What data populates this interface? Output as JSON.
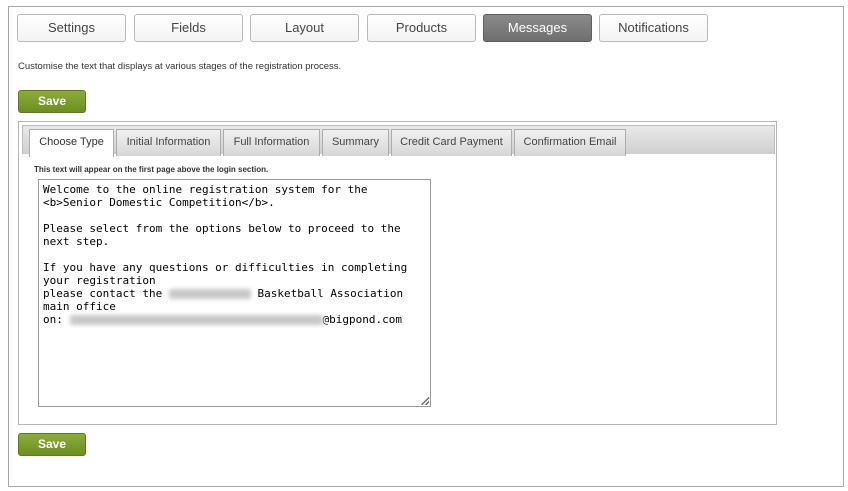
{
  "top_tabs": [
    {
      "label": "Settings"
    },
    {
      "label": "Fields"
    },
    {
      "label": "Layout"
    },
    {
      "label": "Products"
    },
    {
      "label": "Messages",
      "active": true
    },
    {
      "label": "Notifications"
    }
  ],
  "intro_text": "Customise the text that displays at various stages of the registration process.",
  "save_label": "Save",
  "sub_tabs": [
    {
      "label": "Choose Type",
      "active": true
    },
    {
      "label": "Initial Information"
    },
    {
      "label": "Full Information"
    },
    {
      "label": "Summary"
    },
    {
      "label": "Credit Card Payment"
    },
    {
      "label": "Confirmation Email"
    }
  ],
  "helper_text": "This text will appear on the first page above the login section.",
  "message": {
    "line1": "Welcome to the online registration system for the <b>Senior Domestic Competition</b>.",
    "line2": "Please select from the options below to proceed to the next step.",
    "line3": "If you have any questions or difficulties in completing your registration",
    "line4_prefix": "please contact the ",
    "line4_suffix": " Basketball Association main office",
    "line5_prefix": "on: ",
    "line5_suffix": "@bigpond.com"
  },
  "colors": {
    "save_green": "#7a9c2c",
    "active_tab_gray": "#7a7a7a"
  }
}
